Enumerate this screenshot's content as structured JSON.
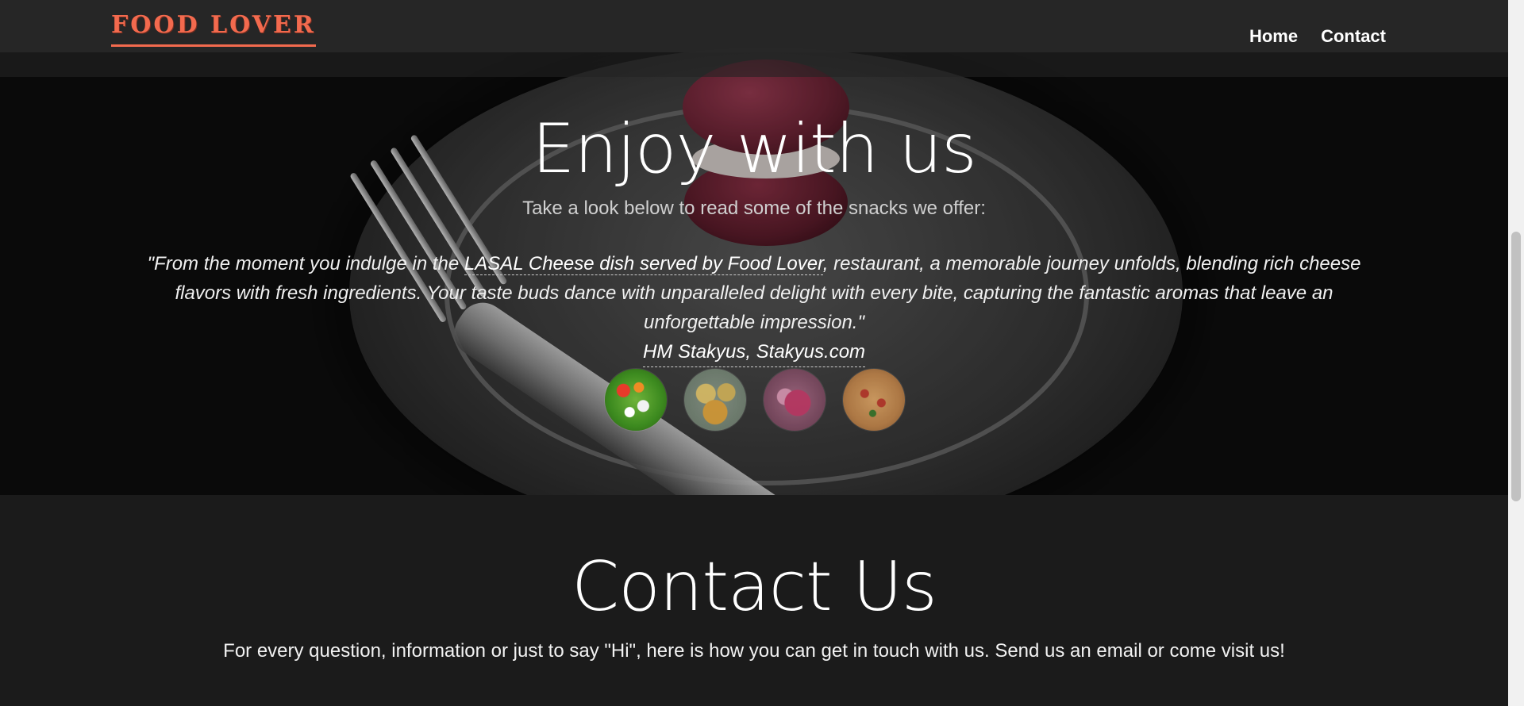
{
  "navbar": {
    "brand": "FOOD LOVER",
    "links": [
      {
        "label": "Home"
      },
      {
        "label": "Contact"
      }
    ]
  },
  "hero": {
    "title": "Enjoy with us",
    "subtitle": "Take a look below to read some of the snacks we offer:",
    "quote": {
      "open": "\"From the moment you indulge in the ",
      "link1": "LASAL Cheese dish served by Food Lover",
      "rest": ", restaurant, a memorable journey unfolds, blending rich cheese flavors with fresh ingredients. Your taste buds dance with unparalleled delight with every bite, capturing the fantastic aromas that leave an unforgettable impression.\"",
      "author_link": "HM Stakyus, Stakyus.com"
    },
    "snacks": [
      {
        "name": "salad-image"
      },
      {
        "name": "chips-image"
      },
      {
        "name": "drink-image"
      },
      {
        "name": "pizza-image"
      }
    ]
  },
  "contact": {
    "title": "Contact Us",
    "text": "For every question, information or just to say \"Hi\", here is how you can get in touch with us. Send us an email or come visit us!"
  },
  "colors": {
    "brand": "#f36a4e",
    "background": "#1b1b1b",
    "navbar": "#282828"
  }
}
